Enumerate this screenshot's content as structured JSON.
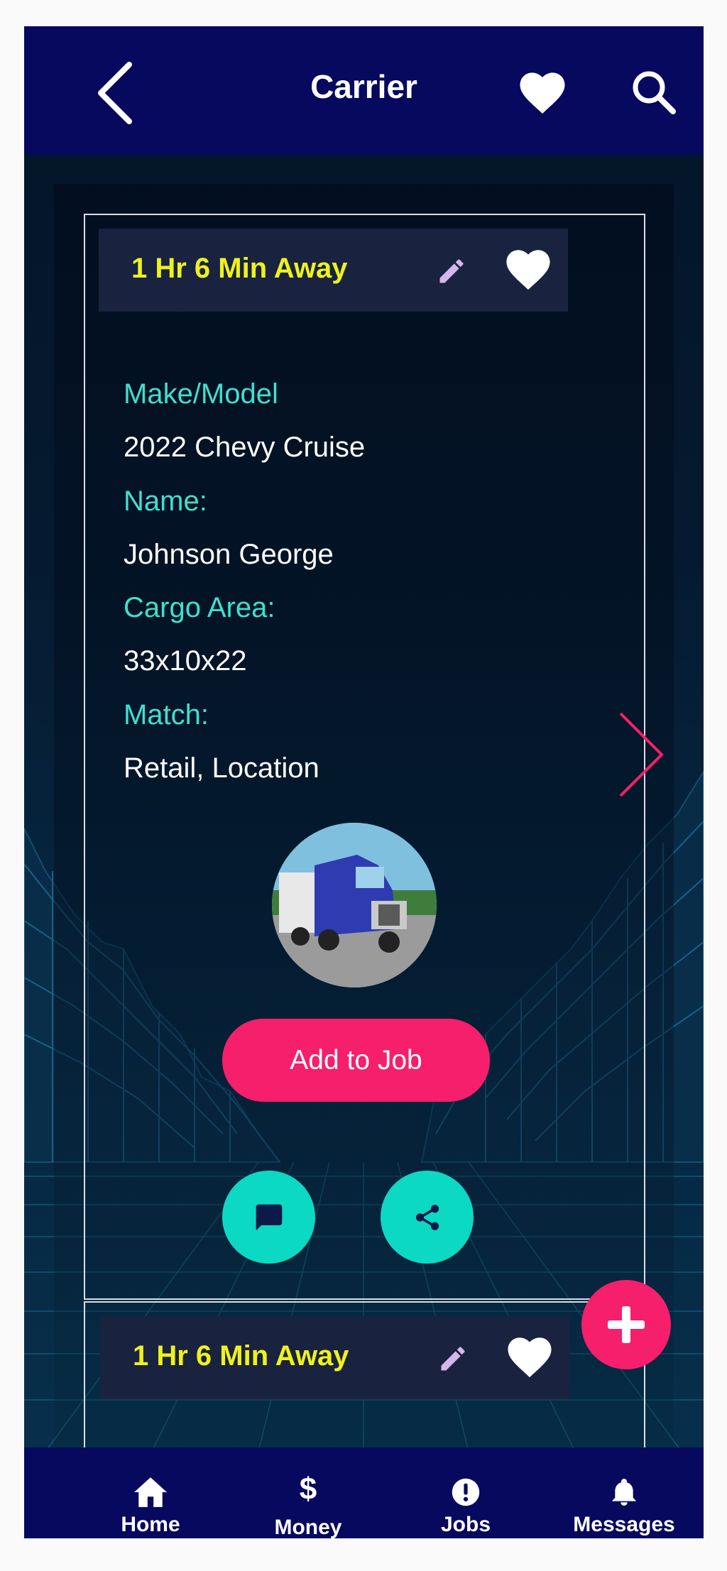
{
  "header": {
    "title": "Carrier",
    "back_icon": "chevron-left-icon",
    "favorite_icon": "heart-icon",
    "search_icon": "search-icon"
  },
  "cards": [
    {
      "eta": "1 Hr 6 Min Away",
      "fields": [
        {
          "label": "Make/Model",
          "value": "2022 Chevy Cruise"
        },
        {
          "label": "Name:",
          "value": "Johnson George"
        },
        {
          "label": "Cargo Area:",
          "value": "33x10x22"
        },
        {
          "label": "Match:",
          "value": "Retail, Location"
        }
      ],
      "action_label": "Add to Job",
      "chat_icon": "chat-bubble-icon",
      "share_icon": "share-icon"
    },
    {
      "eta": "1 Hr 6 Min Away"
    }
  ],
  "fab_icon": "plus-icon",
  "nav": [
    {
      "label": "Home",
      "icon": "home-icon"
    },
    {
      "label": "Money",
      "icon": "$"
    },
    {
      "label": "Jobs",
      "icon": "alert-icon"
    },
    {
      "label": "Messages",
      "icon": "bell-icon"
    }
  ],
  "colors": {
    "header_bg": "#07095e",
    "eta_text": "#eef21c",
    "label_text": "#3fe0cf",
    "accent_pink": "#f51f6b",
    "accent_teal": "#0bd9c4"
  }
}
